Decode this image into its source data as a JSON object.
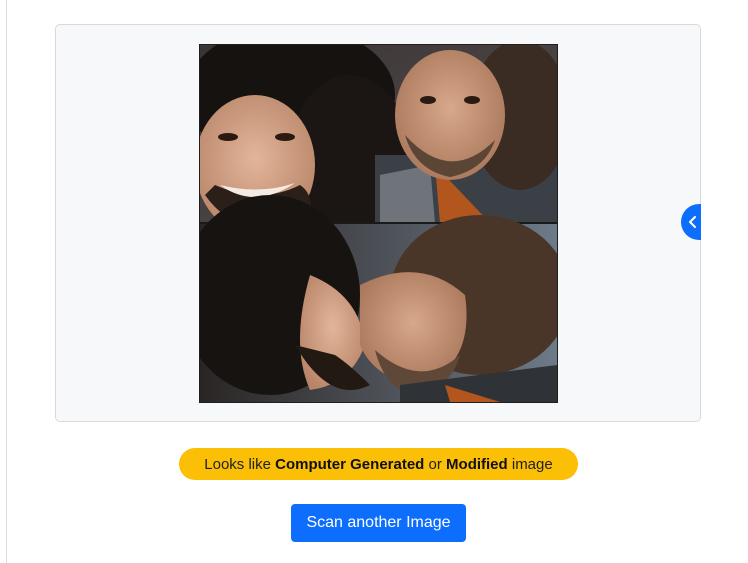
{
  "preview": {
    "image_alt": "Uploaded image: two men, top panel smiling, bottom panel faces touching",
    "collapse_icon": "chevron-left-icon"
  },
  "result": {
    "prefix": "Looks like",
    "label1": "Computer Generated",
    "middle": "or",
    "label2": "Modified",
    "suffix": "image",
    "badge_color": "#fbbf06"
  },
  "actions": {
    "scan_label": "Scan another Image",
    "button_color": "#0d6efd"
  }
}
